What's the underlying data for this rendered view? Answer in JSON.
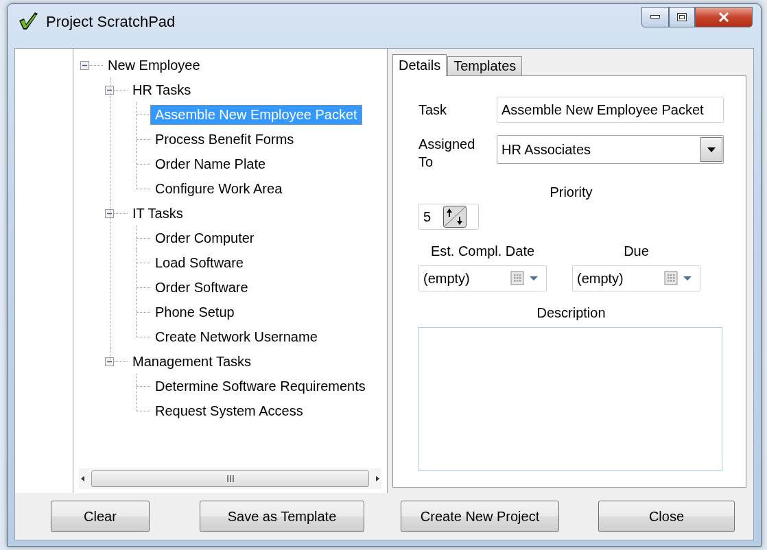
{
  "window": {
    "title": "Project ScratchPad"
  },
  "tree": [
    {
      "label": "New Employee",
      "expanded": true,
      "selected": false,
      "children": [
        {
          "label": "HR Tasks",
          "expanded": true,
          "selected": false,
          "children": [
            {
              "label": "Assemble New Employee Packet",
              "selected": true
            },
            {
              "label": "Process Benefit Forms",
              "selected": false
            },
            {
              "label": "Order Name Plate",
              "selected": false
            },
            {
              "label": "Configure Work Area",
              "selected": false
            }
          ]
        },
        {
          "label": "IT Tasks",
          "expanded": true,
          "selected": false,
          "children": [
            {
              "label": "Order Computer",
              "selected": false
            },
            {
              "label": "Load Software",
              "selected": false
            },
            {
              "label": "Order Software",
              "selected": false
            },
            {
              "label": "Phone Setup",
              "selected": false
            },
            {
              "label": "Create Network Username",
              "selected": false
            }
          ]
        },
        {
          "label": "Management Tasks",
          "expanded": true,
          "selected": false,
          "children": [
            {
              "label": "Determine Software Requirements",
              "selected": false
            },
            {
              "label": "Request System Access",
              "selected": false
            }
          ]
        }
      ]
    }
  ],
  "tabs": [
    {
      "label": "Details",
      "selected": true
    },
    {
      "label": "Templates",
      "selected": false
    }
  ],
  "form": {
    "task_label": "Task",
    "task": "Assemble New Employee Packet",
    "assigned_label": "Assigned To",
    "assigned": "HR Associates",
    "priority_label": "Priority",
    "priority": "5",
    "est_label": "Est. Compl. Date",
    "est": "(empty)",
    "due_label": "Due",
    "due": "(empty)",
    "description_label": "Description"
  },
  "buttons": [
    "Clear",
    "Save as Template",
    "Create New Project",
    "Close"
  ]
}
